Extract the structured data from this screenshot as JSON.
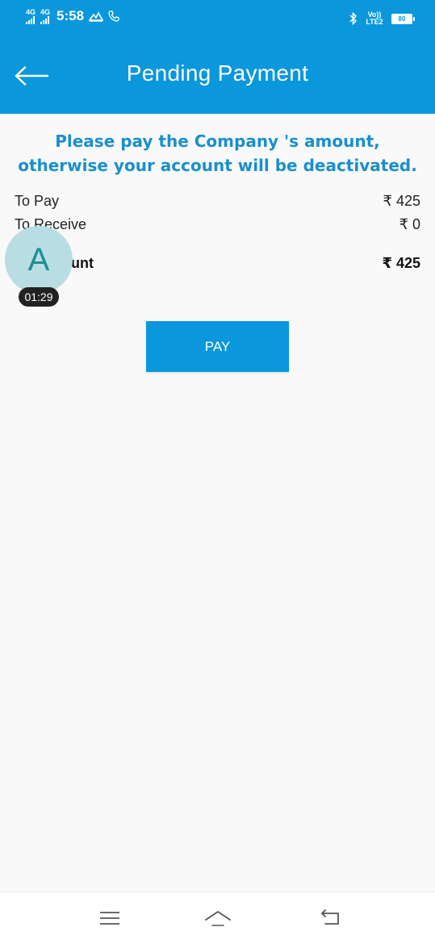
{
  "status_bar": {
    "network1": "4G",
    "network2": "4G",
    "time": "5:58",
    "volte": "Vo)) LTE2",
    "battery": "80"
  },
  "app_bar": {
    "title": "Pending Payment",
    "back_icon": "arrow-left-icon"
  },
  "notice": "Please pay the Company 's amount, otherwise your account will be deactivated.",
  "rows": [
    {
      "label": "To Pay",
      "value": "₹ 425"
    },
    {
      "label": "To Receive",
      "value": "₹ 0"
    },
    {
      "label": "Amount",
      "value": "₹ 425"
    }
  ],
  "avatar": {
    "letter": "A",
    "timer": "01:29"
  },
  "pay_button": {
    "label": "PAY"
  },
  "colors": {
    "primary": "#0a97dc",
    "notice": "#1a8fcd",
    "background": "#f9f9f9"
  },
  "nav": {
    "icons": [
      "menu-icon",
      "home-icon",
      "back-icon"
    ]
  }
}
